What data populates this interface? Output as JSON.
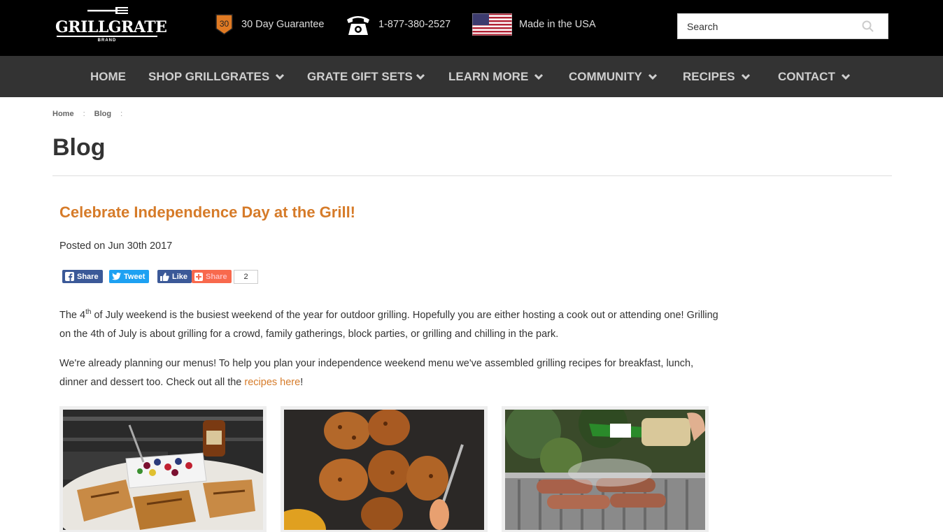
{
  "header": {
    "logo_text": "GRILLGRATE",
    "logo_sub": "BRAND",
    "guarantee_badge": "30",
    "guarantee": "30 Day Guarantee",
    "phone": "1-877-380-2527",
    "made_in": "Made in the USA",
    "search_placeholder": "Search"
  },
  "nav": [
    {
      "label": "HOME",
      "dropdown": false
    },
    {
      "label": "SHOP GRILLGRATES",
      "dropdown": true
    },
    {
      "label": "GRATE GIFT SETS",
      "dropdown": true
    },
    {
      "label": "LEARN MORE",
      "dropdown": true
    },
    {
      "label": "COMMUNITY",
      "dropdown": true
    },
    {
      "label": "RECIPES",
      "dropdown": true
    },
    {
      "label": "CONTACT",
      "dropdown": true
    }
  ],
  "breadcrumb": [
    "Home",
    "Blog"
  ],
  "page_title": "Blog",
  "post": {
    "title": "Celebrate Independence Day at the Grill!",
    "posted": "Posted on Jun 30th 2017",
    "share_buttons": {
      "facebook": "Share",
      "twitter": "Tweet",
      "like": "Like",
      "addthis": "Share",
      "count": "2"
    },
    "p1_a": "The 4",
    "p1_sup": "th",
    "p1_b": " of July weekend is the busiest weekend of the year for outdoor grilling. Hopefully you are either hosting a cook out or attending one! Grilling on the 4th of July is about grilling for a crowd, family gatherings, block parties, or grilling and chilling in the park.",
    "p2_a": "We're already planning our menus! To help you plan your independence weekend menu we've assembled grilling recipes for breakfast, lunch, dinner and dessert too. Check out all the ",
    "p2_link": "recipes here",
    "p2_b": "!"
  },
  "colors": {
    "accent": "#d67b29",
    "nav_bg": "#333333",
    "facebook": "#3b5998",
    "twitter": "#1da1f2",
    "addthis": "#f8694d"
  }
}
